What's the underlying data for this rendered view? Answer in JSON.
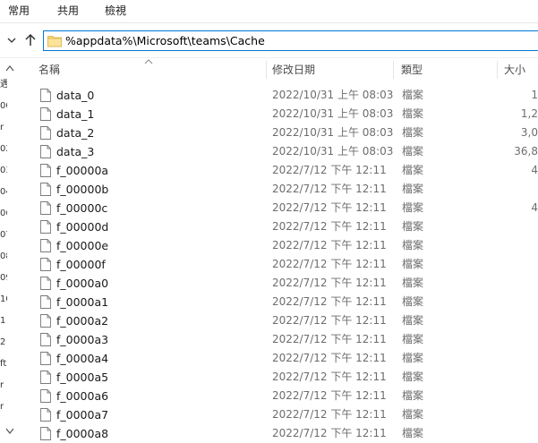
{
  "ribbon": {
    "tabs": [
      {
        "label": "常用"
      },
      {
        "label": "共用"
      },
      {
        "label": "檢視"
      }
    ]
  },
  "address": {
    "value": "%appdata%\\Microsoft\\teams\\Cache"
  },
  "columns": {
    "name": "名稱",
    "date": "修改日期",
    "type": "類型",
    "size": "大小"
  },
  "navpane": {
    "fragments": [
      "遇",
      "00",
      "r",
      "02",
      "03",
      "04",
      "06",
      "07",
      "08",
      "09",
      "10",
      "1",
      "2",
      "ft",
      "r",
      "r"
    ]
  },
  "files": [
    {
      "name": "data_0",
      "date": "2022/10/31 上午 08:03",
      "type": "檔案",
      "size": "1"
    },
    {
      "name": "data_1",
      "date": "2022/10/31 上午 08:03",
      "type": "檔案",
      "size": "1,2"
    },
    {
      "name": "data_2",
      "date": "2022/10/31 上午 08:03",
      "type": "檔案",
      "size": "3,0"
    },
    {
      "name": "data_3",
      "date": "2022/10/31 上午 08:03",
      "type": "檔案",
      "size": "36,8"
    },
    {
      "name": "f_00000a",
      "date": "2022/7/12 下午 12:11",
      "type": "檔案",
      "size": "4"
    },
    {
      "name": "f_00000b",
      "date": "2022/7/12 下午 12:11",
      "type": "檔案",
      "size": ""
    },
    {
      "name": "f_00000c",
      "date": "2022/7/12 下午 12:11",
      "type": "檔案",
      "size": "4"
    },
    {
      "name": "f_00000d",
      "date": "2022/7/12 下午 12:11",
      "type": "檔案",
      "size": ""
    },
    {
      "name": "f_00000e",
      "date": "2022/7/12 下午 12:11",
      "type": "檔案",
      "size": ""
    },
    {
      "name": "f_00000f",
      "date": "2022/7/12 下午 12:11",
      "type": "檔案",
      "size": ""
    },
    {
      "name": "f_0000a0",
      "date": "2022/7/12 下午 12:11",
      "type": "檔案",
      "size": ""
    },
    {
      "name": "f_0000a1",
      "date": "2022/7/12 下午 12:11",
      "type": "檔案",
      "size": ""
    },
    {
      "name": "f_0000a2",
      "date": "2022/7/12 下午 12:11",
      "type": "檔案",
      "size": ""
    },
    {
      "name": "f_0000a3",
      "date": "2022/7/12 下午 12:11",
      "type": "檔案",
      "size": ""
    },
    {
      "name": "f_0000a4",
      "date": "2022/7/12 下午 12:11",
      "type": "檔案",
      "size": ""
    },
    {
      "name": "f_0000a5",
      "date": "2022/7/12 下午 12:11",
      "type": "檔案",
      "size": ""
    },
    {
      "name": "f_0000a6",
      "date": "2022/7/12 下午 12:11",
      "type": "檔案",
      "size": ""
    },
    {
      "name": "f_0000a7",
      "date": "2022/7/12 下午 12:11",
      "type": "檔案",
      "size": ""
    },
    {
      "name": "f_0000a8",
      "date": "2022/7/12 下午 12:11",
      "type": "檔案",
      "size": ""
    }
  ],
  "colors": {
    "accent": "#0078d7",
    "folder": "#f8d775",
    "header_text": "#4c4c4c",
    "secondary_text": "#6d6d6d"
  }
}
